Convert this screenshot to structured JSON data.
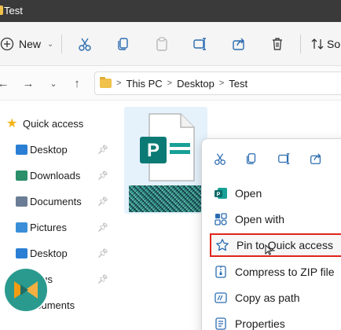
{
  "window": {
    "title": "Test"
  },
  "toolbar": {
    "new_label": "New",
    "sort_label": "So",
    "icons": [
      "cut-icon",
      "copy-icon",
      "paste-icon",
      "rename-icon",
      "share-icon",
      "delete-icon"
    ]
  },
  "address_bar": {
    "crumbs": [
      "This PC",
      "Desktop",
      "Test"
    ]
  },
  "sidebar": {
    "items": [
      {
        "label": "Quick access",
        "icon": "star-icon",
        "color": "#f2b418",
        "pinned": false
      },
      {
        "label": "Desktop",
        "icon": "desktop-folder-icon",
        "color": "#2a7fd4",
        "pinned": true
      },
      {
        "label": "Downloads",
        "icon": "downloads-folder-icon",
        "color": "#2a8f6a",
        "pinned": true
      },
      {
        "label": "Documents",
        "icon": "documents-folder-icon",
        "color": "#6b7d95",
        "pinned": true
      },
      {
        "label": "Pictures",
        "icon": "pictures-folder-icon",
        "color": "#3a8fd8",
        "pinned": true
      },
      {
        "label": "Desktop",
        "icon": "desktop-folder-icon",
        "color": "#2a7fd4",
        "pinned": true
      },
      {
        "label": "ngs",
        "icon": "folder-icon",
        "color": "#f0c14b",
        "pinned": true
      },
      {
        "label": "cuments",
        "icon": "documents-folder-icon",
        "color": "#6b7d95",
        "pinned": false
      }
    ]
  },
  "file": {
    "icon": "publisher-file-icon",
    "letter": "P",
    "accent": "#0b7a74"
  },
  "context_menu": {
    "quick_actions": [
      "cut-icon",
      "copy-icon",
      "rename-icon",
      "share-icon"
    ],
    "items": [
      {
        "label": "Open",
        "icon": "publisher-app-icon",
        "highlighted": false
      },
      {
        "label": "Open with",
        "icon": "open-with-icon",
        "highlighted": false
      },
      {
        "label": "Pin to Quick access",
        "icon": "star-outline-icon",
        "highlighted": true
      },
      {
        "label": "Compress to ZIP file",
        "icon": "zip-icon",
        "highlighted": false
      },
      {
        "label": "Copy as path",
        "icon": "copy-path-icon",
        "highlighted": false
      },
      {
        "label": "Properties",
        "icon": "properties-icon",
        "highlighted": false
      }
    ],
    "highlight_color": "#e0241b"
  }
}
